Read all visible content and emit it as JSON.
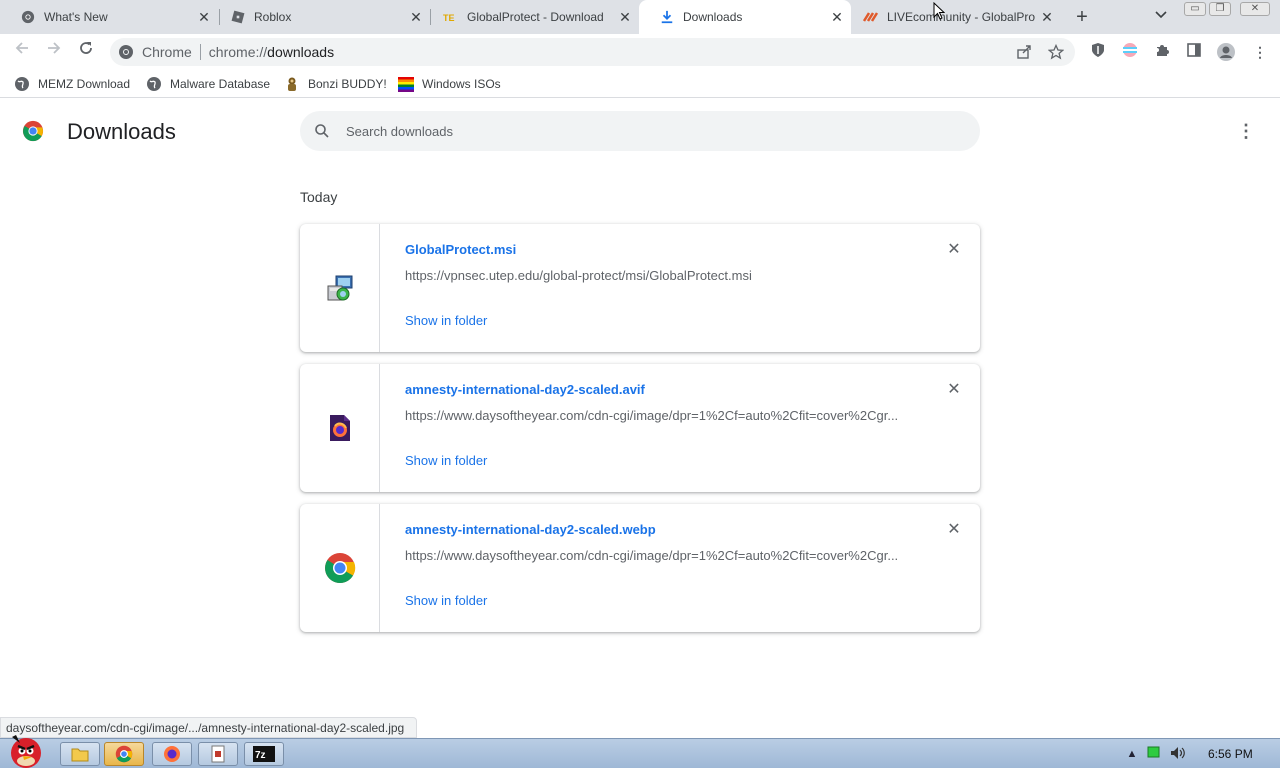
{
  "tabs": [
    {
      "label": "What's New",
      "icon": "chrome-icon",
      "active": false
    },
    {
      "label": "Roblox",
      "icon": "roblox-icon",
      "active": false
    },
    {
      "label": "GlobalProtect - Download",
      "icon": "globalprotect-tab-icon",
      "active": false
    },
    {
      "label": "Downloads",
      "icon": "download-arrow-icon",
      "active": true
    },
    {
      "label": "LIVEcommunity - GlobalPro",
      "icon": "livecommunity-icon",
      "active": false
    }
  ],
  "window_controls": {
    "minimize": "▭",
    "restore": "❐",
    "close": "✕"
  },
  "omnibox": {
    "chip": "Chrome",
    "url_scheme": "chrome://",
    "url_host": "downloads"
  },
  "bookmarks": [
    {
      "label": "MEMZ Download",
      "icon": "globe-icon"
    },
    {
      "label": "Malware Database",
      "icon": "globe-icon"
    },
    {
      "label": "Bonzi BUDDY!",
      "icon": "bonzi-icon"
    },
    {
      "label": "Windows ISOs",
      "icon": "windows-flag-icon"
    }
  ],
  "page": {
    "title": "Downloads",
    "search_placeholder": "Search downloads",
    "date_group": "Today"
  },
  "downloads": [
    {
      "filename": "GlobalProtect.msi",
      "url": "https://vpnsec.utep.edu/global-protect/msi/GlobalProtect.msi",
      "action": "Show in folder",
      "icon": "msi-installer-icon"
    },
    {
      "filename": "amnesty-international-day2-scaled.avif",
      "url": "https://www.daysoftheyear.com/cdn-cgi/image/dpr=1%2Cf=auto%2Cfit=cover%2Cgr...",
      "action": "Show in folder",
      "icon": "firefox-file-icon"
    },
    {
      "filename": "amnesty-international-day2-scaled.webp",
      "url": "https://www.daysoftheyear.com/cdn-cgi/image/dpr=1%2Cf=auto%2Cfit=cover%2Cgr...",
      "action": "Show in folder",
      "icon": "chrome-file-icon"
    }
  ],
  "status_bar": "daysoftheyear.com/cdn-cgi/image/.../amnesty-international-day2-scaled.jpg",
  "taskbar": {
    "clock": "6:56 PM"
  },
  "colors": {
    "link": "#1a73e8",
    "tabstrip": "#dee1e6",
    "omnibox": "#f1f3f4"
  }
}
